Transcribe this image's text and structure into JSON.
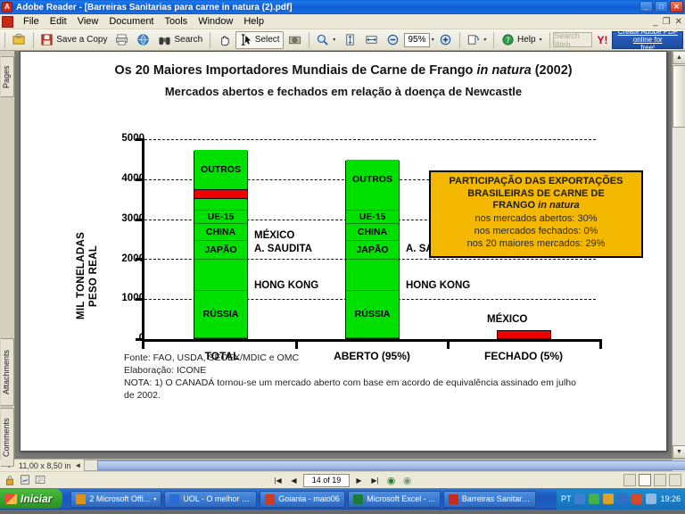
{
  "window": {
    "app_icon": "adobe-reader-icon",
    "title": "Adobe Reader - [Barreiras Sanitarias para carne in natura (2).pdf]",
    "min_label": "_",
    "max_label": "□",
    "close_label": "✕",
    "mdi_min": "_",
    "mdi_restore": "❐",
    "mdi_close": "✕"
  },
  "menu": {
    "items": [
      "File",
      "Edit",
      "View",
      "Document",
      "Tools",
      "Window",
      "Help"
    ]
  },
  "toolbar": {
    "open_label": "",
    "save_copy_label": "Save a Copy",
    "print_label": "",
    "email_label": "",
    "search_label": "Search",
    "hand_label": "",
    "select_label": "Select",
    "snapshot_label": "",
    "zoom_tool_label": "",
    "zoom_in_label": "",
    "fit_page_label": "",
    "fit_width_label": "",
    "zoom_out_label": "",
    "zoom_value": "95%",
    "actual_size_label": "",
    "rotate_label": "",
    "help_label": "Help",
    "yahoo_search_placeholder": "Search Web",
    "yahoo_logo": "Y!",
    "cta_line1": "Create Adobe PDF online for",
    "cta_line2": "free!",
    "dropdown_caret": "▾"
  },
  "navigation_tabs": [
    {
      "label": "Pages",
      "name": "nav-tab-pages"
    },
    {
      "label": "Attachments",
      "name": "nav-tab-attachments"
    },
    {
      "label": "Comments",
      "name": "nav-tab-comments"
    }
  ],
  "statusbar": {
    "page_dimensions": "11,00 x 8,50 in",
    "page_indicator": "14 of 19",
    "first_page_icon": "first-page-icon",
    "prev_page_icon": "previous-page-icon",
    "next_page_icon": "next-page-icon",
    "last_page_icon": "last-page-icon",
    "prev_view_icon": "previous-view-icon",
    "next_view_icon": "next-view-icon"
  },
  "taskbar": {
    "start_label": "Iniciar",
    "clock": "19:26",
    "language": "PT",
    "tasks": [
      {
        "label": "2 Microsoft Offi...",
        "icon_color": "#e0920f",
        "has_dropdown": true
      },
      {
        "label": "UOL - O melhor c...",
        "icon_color": "#2a6bd4",
        "has_dropdown": false
      },
      {
        "label": "Goiania - maio06",
        "icon_color": "#d03a20",
        "has_dropdown": false
      },
      {
        "label": "Microsoft Excel - ...",
        "icon_color": "#1c7a3c",
        "has_dropdown": false
      },
      {
        "label": "Barreiras Sanitari...",
        "icon_color": "#c92a18",
        "has_dropdown": false
      }
    ]
  },
  "document": {
    "title_line1": "Os 20 Maiores Importadores Mundiais de Carne de Frango ",
    "title_line1_italic": "in natura",
    "title_line1_tail": " (2002)",
    "title_line2": "Mercados abertos e fechados em relação à doença de Newcastle",
    "callout": {
      "heading_line1": "PARTICIPAÇÃO DAS EXPORTAÇÕES",
      "heading_line2": "BRASILEIRAS DE CARNE DE",
      "heading_line3": "FRANGO ",
      "heading_line3_italic": "in natura",
      "body_line1": "nos mercados abertos: 30%",
      "body_line2": "nos mercados fechados: 0%",
      "body_line3": "nos 20 maiores mercados: 29%"
    },
    "footnotes": [
      "Fonte: FAO, USDA, SECEX/MDIC e OMC",
      "Elaboração: ICONE",
      "NOTA: 1) O CANADÁ tornou-se um mercado aberto com base em acordo de equivalência assinado em julho",
      "de 2002."
    ]
  },
  "chart_data": {
    "type": "bar",
    "subtype": "stacked",
    "title": "Os 20 Maiores Importadores Mundiais de Carne de Frango in natura (2002)",
    "subtitle": "Mercados abertos e fechados em relação à doença de Newcastle",
    "xlabel": "",
    "ylabel": "MIL TONELADAS PESO REAL",
    "ylabel_line1": "MIL TONELADAS",
    "ylabel_line2": "PESO REAL",
    "ylim": [
      0,
      5000
    ],
    "yticks": [
      0,
      1000,
      2000,
      3000,
      4000,
      5000
    ],
    "ytick_labels": [
      "0",
      "1000",
      "2000",
      "3000",
      "4000",
      "5000"
    ],
    "grid": true,
    "legend": "none",
    "categories": [
      "TOTAL",
      "ABERTO (95%)",
      "FECHADO (5%)"
    ],
    "colors": {
      "open_market": "#00e000",
      "closed_market": "#ee0000"
    },
    "bars": [
      {
        "category": "TOTAL",
        "total": 4710,
        "segments": [
          {
            "label": "RÚSSIA",
            "value": 1180,
            "color": "#00e000",
            "label_position": "inside"
          },
          {
            "label": "HONG KONG",
            "value": 790,
            "color": "#00e000",
            "label_position": "outside"
          },
          {
            "label": "JAPÃO",
            "value": 460,
            "color": "#00e000",
            "label_position": "inside"
          },
          {
            "label": "CHINA",
            "value": 420,
            "color": "#00e000",
            "label_position": "inside"
          },
          {
            "label": "UE-15",
            "value": 340,
            "color": "#00e000",
            "label_position": "inside"
          },
          {
            "label": "A. SAUDITA",
            "value": 300,
            "color": "#00e000",
            "label_position": "outside"
          },
          {
            "label": "MÉXICO",
            "value": 230,
            "color": "#ee0000",
            "label_position": "outside"
          },
          {
            "label": "OUTROS",
            "value": 990,
            "color": "#00e000",
            "label_position": "inside"
          }
        ]
      },
      {
        "category": "ABERTO (95%)",
        "total": 4480,
        "segments": [
          {
            "label": "RÚSSIA",
            "value": 1180,
            "color": "#00e000",
            "label_position": "inside"
          },
          {
            "label": "HONG KONG",
            "value": 790,
            "color": "#00e000",
            "label_position": "outside"
          },
          {
            "label": "JAPÃO",
            "value": 460,
            "color": "#00e000",
            "label_position": "inside"
          },
          {
            "label": "CHINA",
            "value": 420,
            "color": "#00e000",
            "label_position": "inside"
          },
          {
            "label": "UE-15",
            "value": 340,
            "color": "#00e000",
            "label_position": "inside"
          },
          {
            "label": "A. SAUDITA",
            "value": 300,
            "color": "#00e000",
            "label_position": "outside"
          },
          {
            "label": "OUTROS",
            "value": 990,
            "color": "#00e000",
            "label_position": "inside"
          }
        ]
      },
      {
        "category": "FECHADO (5%)",
        "total": 230,
        "segments": [
          {
            "label": "MÉXICO",
            "value": 230,
            "color": "#ee0000",
            "label_position": "above"
          }
        ]
      }
    ]
  }
}
